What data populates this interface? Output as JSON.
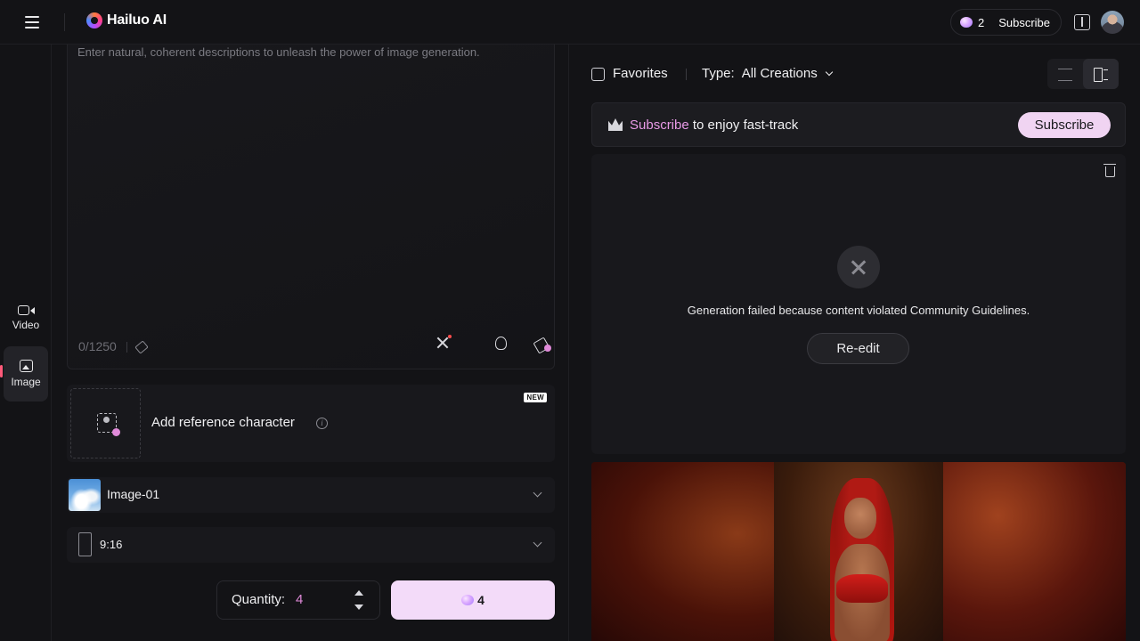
{
  "topbar": {
    "brand": "Hailuo AI",
    "credits": "2",
    "subscribe_label": "Subscribe"
  },
  "nav": {
    "items": [
      {
        "label": "Video",
        "icon": "video-icon",
        "active": false
      },
      {
        "label": "Image",
        "icon": "image-icon",
        "active": true
      }
    ]
  },
  "prompt": {
    "placeholder": "Enter natural, coherent descriptions to unleash the power of image generation.",
    "value": "",
    "counter": "0/1250"
  },
  "reference": {
    "label": "Add reference character",
    "badge": "NEW"
  },
  "model": {
    "selected": "Image-01"
  },
  "aspect_ratio": {
    "selected": "9:16"
  },
  "quantity": {
    "label": "Quantity:",
    "value": "4"
  },
  "generate": {
    "cost": "4"
  },
  "results": {
    "favorites_label": "Favorites",
    "type_label": "Type:",
    "type_value": "All Creations",
    "banner": {
      "link": "Subscribe",
      "text": " to enjoy fast-track",
      "button": "Subscribe"
    },
    "failed": {
      "message": "Generation failed because content violated Community Guidelines.",
      "action": "Re-edit"
    }
  },
  "colors": {
    "accent_pink": "#e089d9",
    "generate_bg": "#f3dbf9",
    "background": "#131316"
  }
}
